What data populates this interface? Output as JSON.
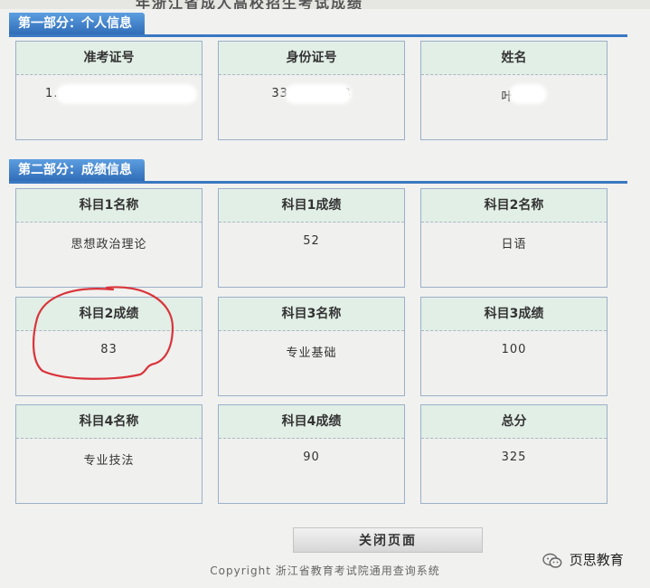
{
  "page": {
    "title_fragment": "年浙江省成人高校招生考试成绩"
  },
  "section1": {
    "title": "第一部分：个人信息",
    "fields": [
      {
        "label": "准考证号",
        "value": "1…"
      },
      {
        "label": "身份证号",
        "value": "3303…1118"
      },
      {
        "label": "姓名",
        "value": "叶…"
      }
    ]
  },
  "section2": {
    "title": "第二部分：成绩信息",
    "fields": [
      {
        "label": "科目1名称",
        "value": "思想政治理论"
      },
      {
        "label": "科目1成绩",
        "value": "52"
      },
      {
        "label": "科目2名称",
        "value": "日语"
      },
      {
        "label": "科目2成绩",
        "value": "83"
      },
      {
        "label": "科目3名称",
        "value": "专业基础"
      },
      {
        "label": "科目3成绩",
        "value": "100"
      },
      {
        "label": "科目4名称",
        "value": "专业技法"
      },
      {
        "label": "科目4成绩",
        "value": "90"
      },
      {
        "label": "总分",
        "value": "325"
      }
    ]
  },
  "actions": {
    "close_label": "关闭页面"
  },
  "footer": {
    "copyright": "Copyright 浙江省教育考试院通用查询系统"
  },
  "watermark": {
    "text": "页思教育"
  },
  "colors": {
    "accent": "#3a78c1",
    "card_head": "#e2efe6",
    "annotation": "#d9343b"
  }
}
